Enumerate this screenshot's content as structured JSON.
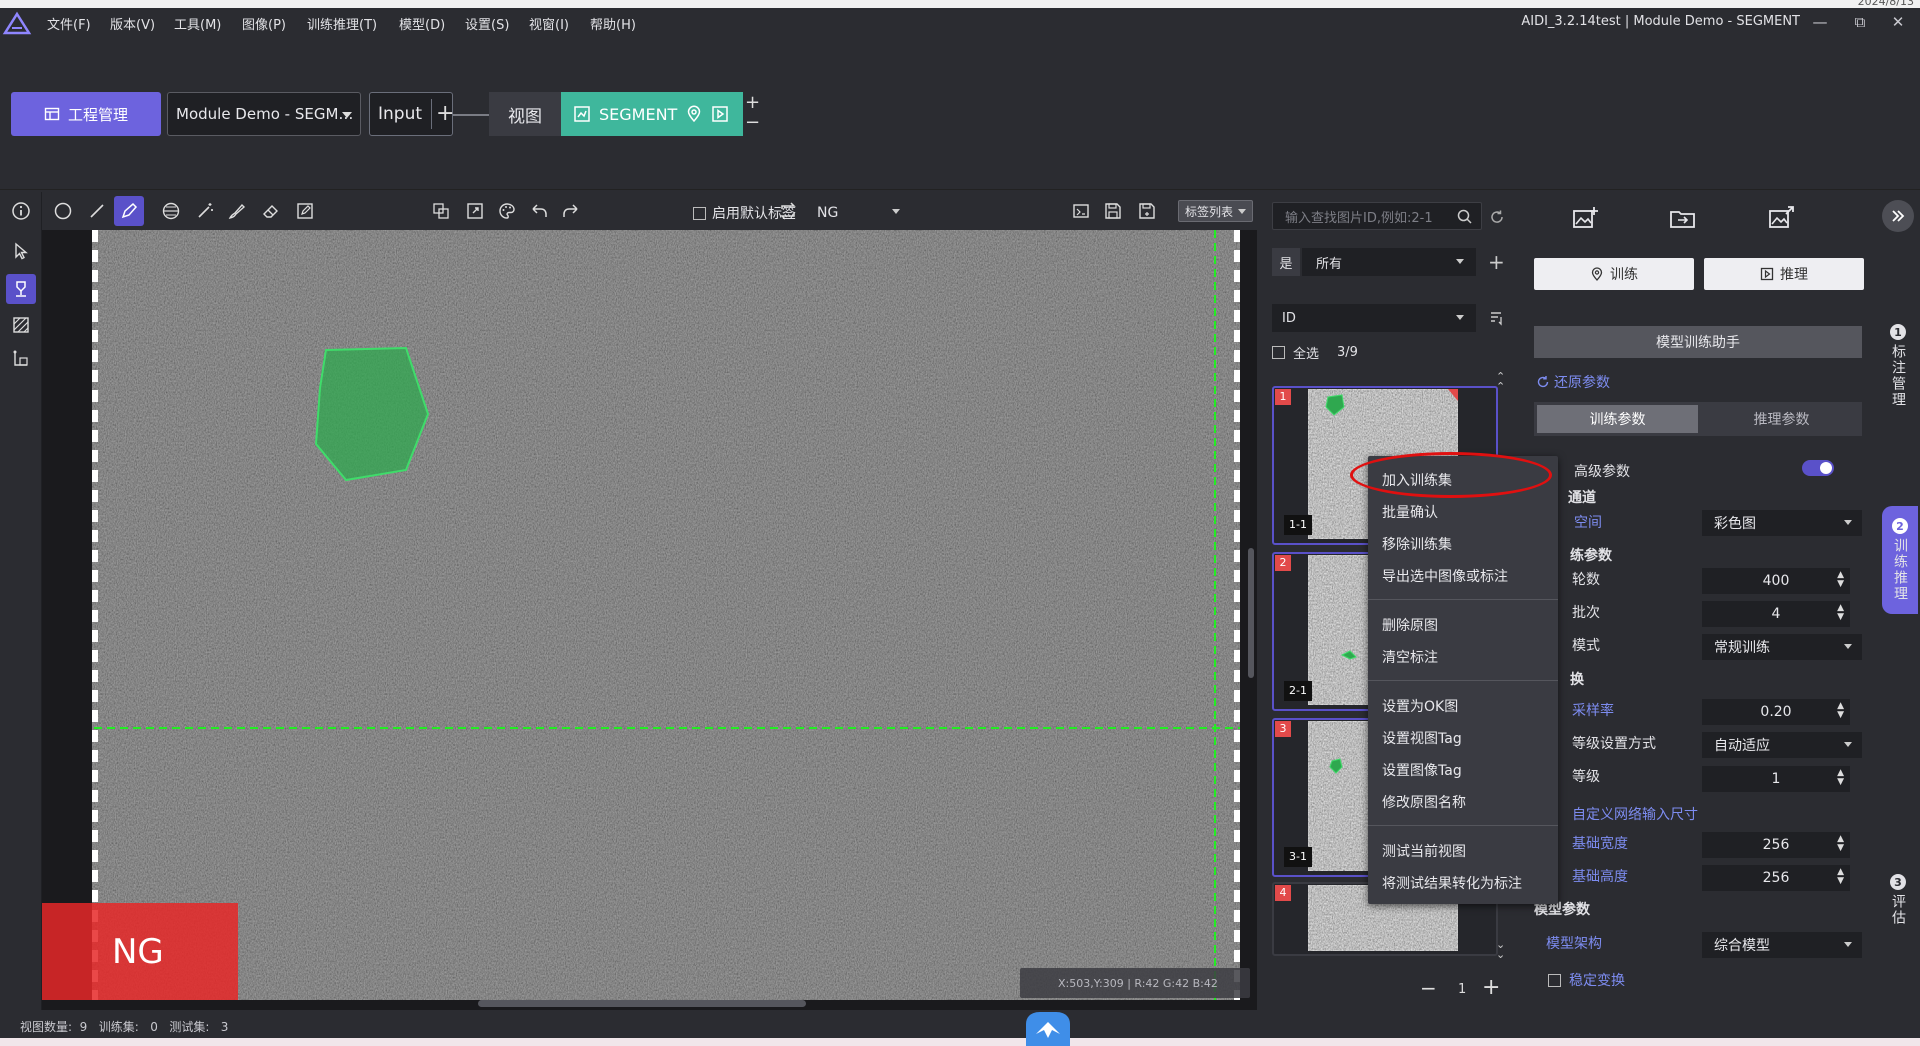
{
  "window": {
    "date_tag": "2024/8/13",
    "title": "AIDI_3.2.14test | Module Demo - SEGMENT",
    "minimize": "—",
    "restore": "⧉",
    "close": "✕"
  },
  "menu": {
    "items": [
      "文件(F)",
      "版本(V)",
      "工具(M)",
      "图像(P)",
      "训练推理(T)",
      "模型(D)",
      "设置(S)",
      "视窗(I)",
      "帮助(H)"
    ]
  },
  "project_bar": {
    "manage_label": "工程管理",
    "project_name": "Module Demo - SEGM…",
    "input_node": "Input",
    "view_node": "视图",
    "segment_node": "SEGMENT"
  },
  "image_toolbar": {
    "default_label_text": "启用默认标签",
    "default_label_checked": false,
    "ng_value": "NG",
    "label_list_button": "标签列表"
  },
  "canvas": {
    "ng_overlay": "NG",
    "coordinates": "X:503,Y:309 | R:42 G:42 B:42"
  },
  "status": {
    "text": "视图数量:  9   训练集:   0   测试集:   3"
  },
  "image_list": {
    "search_placeholder": "输入查找图片ID,例如:2-1",
    "filter_label": "是",
    "filter_value": "所有",
    "sort_value": "ID",
    "select_all": "全选",
    "count": "3/9",
    "thumbnails": [
      {
        "num": "1",
        "caption": "1-1"
      },
      {
        "num": "2",
        "caption": "2-1"
      },
      {
        "num": "3",
        "caption": "3-1"
      },
      {
        "num": "4",
        "caption": ""
      }
    ],
    "page": "1"
  },
  "context_menu": {
    "items": [
      "加入训练集",
      "批量确认",
      "移除训练集",
      "导出选中图像或标注",
      "删除原图",
      "清空标注",
      "设置为OK图",
      "设置视图Tag",
      "设置图像Tag",
      "修改原图名称",
      "测试当前视图",
      "将测试结果转化为标注"
    ]
  },
  "params": {
    "train_btn": "训练",
    "infer_btn": "推理",
    "assistant": "模型训练助手",
    "restore": "还原参数",
    "tab_train": "训练参数",
    "tab_infer": "推理参数",
    "advanced": "高级参数",
    "advanced_on": true,
    "channel_header": "通道",
    "color_space_label": "空间",
    "color_space_value": "彩色图",
    "train_header": "练参数",
    "epochs_label": "轮数",
    "epochs_value": "400",
    "batch_label": "批次",
    "batch_value": "4",
    "mode_label": "模式",
    "mode_value": "常规训练",
    "transform_header": "换",
    "sample_rate_label": "采样率",
    "sample_rate_value": "0.20",
    "level_mode_label": "等级设置方式",
    "level_mode_value": "自动适应",
    "level_label": "等级",
    "level_value": "1",
    "custom_input_label": "自定义网络输入尺寸",
    "base_width_label": "基础宽度",
    "base_width_value": "256",
    "base_height_label": "基础高度",
    "base_height_value": "256",
    "model_params_header": "模型参数",
    "arch_label": "模型架构",
    "arch_value": "综合模型",
    "stable_transform": "稳定变换"
  },
  "vertical_tabs": [
    {
      "num": "1",
      "label": "标注管理"
    },
    {
      "num": "2",
      "label": "训练推理"
    },
    {
      "num": "3",
      "label": "评估"
    }
  ],
  "colors": {
    "accent": "#6d63de",
    "segment_green": "#3fb79c",
    "ng_red": "#e62828",
    "annotation_green": "#2fa84f",
    "highlight_red": "#e01010"
  }
}
